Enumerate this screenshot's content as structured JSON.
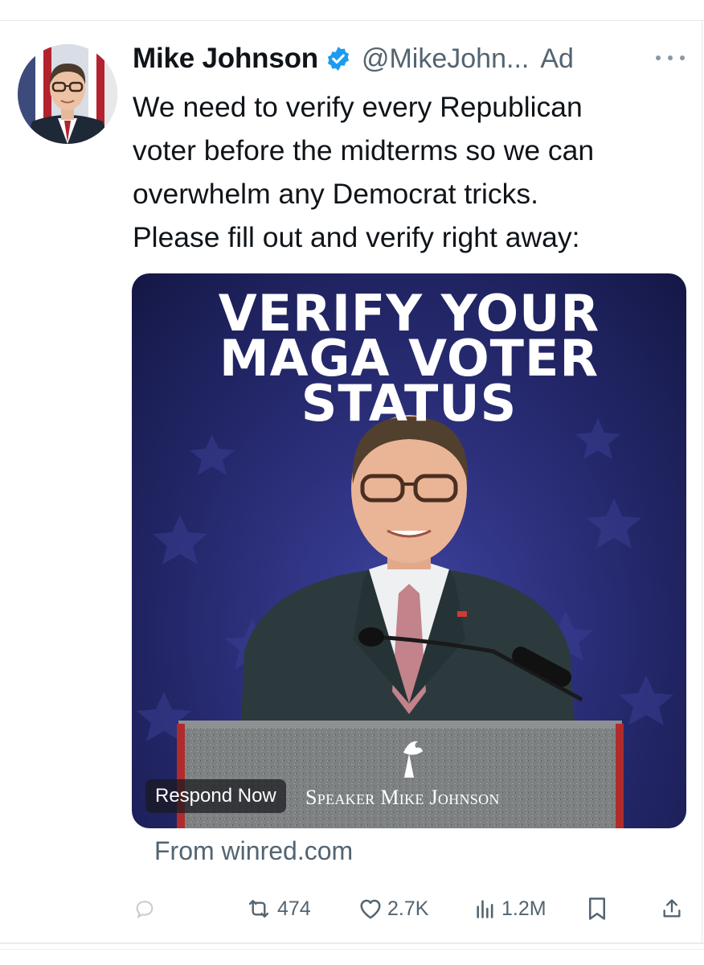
{
  "tweet": {
    "author": {
      "display_name": "Mike Johnson",
      "handle": "@MikeJohn...",
      "verified": true
    },
    "ad_label": "Ad",
    "text_lines": [
      "We need to verify every Republican",
      "voter before the midterms so we can",
      "overwhelm any Democrat tricks.",
      "Please fill out and verify right away:"
    ],
    "media": {
      "headline_lines": [
        "VERIFY YOUR",
        "MAGA VOTER",
        "STATUS"
      ],
      "cta_label": "Respond Now",
      "brand_text": "Speaker Mike Johnson"
    },
    "source": "From winred.com",
    "metrics": {
      "retweets": "474",
      "likes": "2.7K",
      "views": "1.2M"
    }
  },
  "icons": {
    "more": "more-icon",
    "verified": "verified-badge-icon",
    "reply": "reply-icon",
    "retweet": "retweet-icon",
    "like": "heart-icon",
    "views": "views-icon",
    "bookmark": "bookmark-icon",
    "share": "share-icon"
  },
  "colors": {
    "text": "#0f1419",
    "secondary": "#536471",
    "verified_blue": "#1d9bf0",
    "media_background": "#2b2f7c"
  }
}
